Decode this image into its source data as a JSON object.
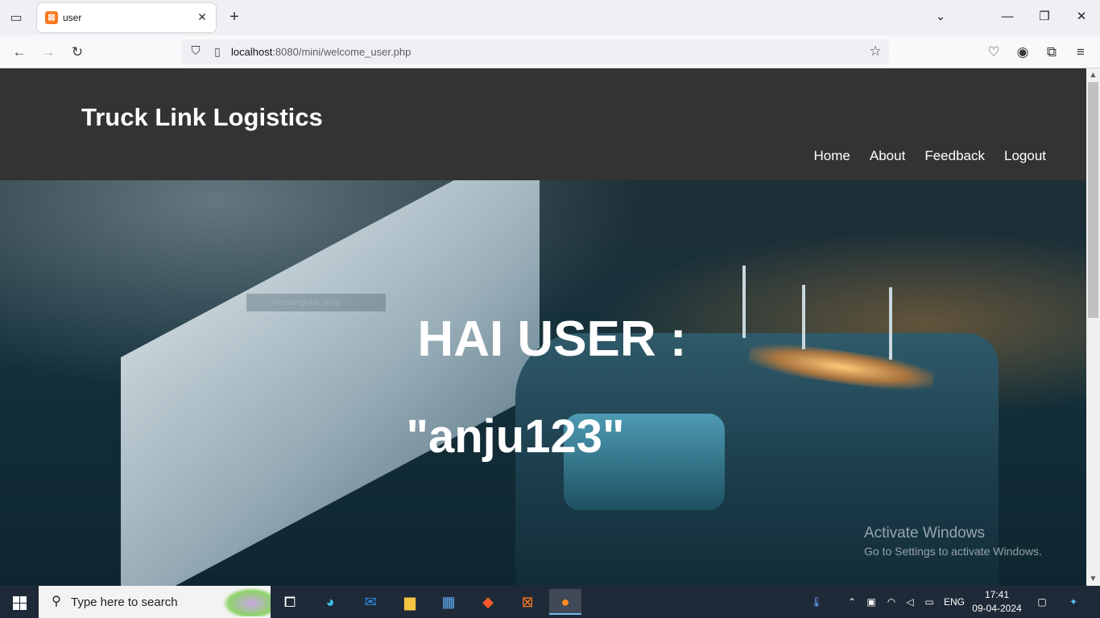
{
  "browser": {
    "tab_title": "user",
    "url_host": "localhost",
    "url_rest": ":8080/mini/welcome_user.php"
  },
  "site": {
    "title": "Truck Link Logistics",
    "nav": [
      "Home",
      "About",
      "Feedback",
      "Logout"
    ],
    "greeting_line1": "HAI USER :",
    "greeting_line2": "\"anju123\"",
    "snip_overlay": "Rectangular Snip"
  },
  "windows_watermark": {
    "line1": "Activate Windows",
    "line2": "Go to Settings to activate Windows."
  },
  "taskbar": {
    "search_placeholder": "Type here to search",
    "language": "ENG",
    "time": "17:41",
    "date": "09-04-2024"
  },
  "colors": {
    "header_bg": "#333333",
    "taskbar_bg": "#1f2a38"
  }
}
